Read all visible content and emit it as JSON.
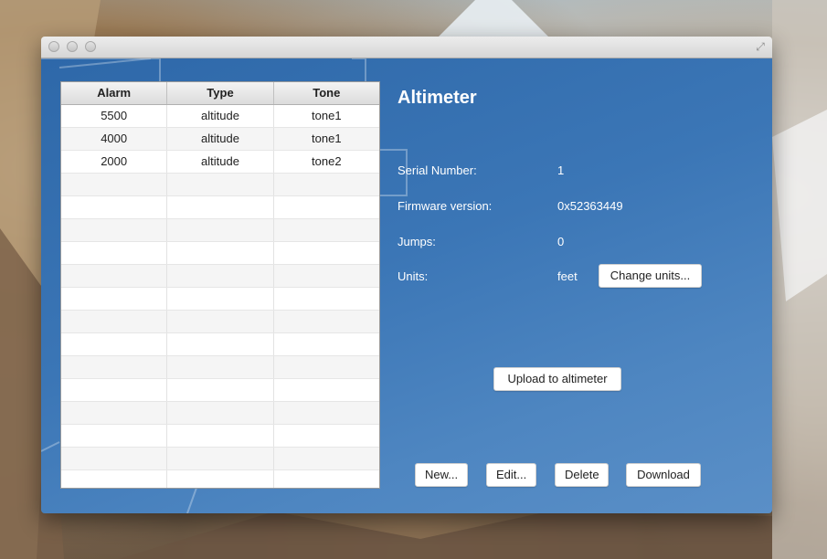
{
  "app": {
    "title": "Altimeter"
  },
  "table": {
    "columns": [
      "Alarm",
      "Type",
      "Tone"
    ],
    "rows": [
      [
        "5500",
        "altitude",
        "tone1"
      ],
      [
        "4000",
        "altitude",
        "tone1"
      ],
      [
        "2000",
        "altitude",
        "tone2"
      ]
    ]
  },
  "info": {
    "serial_label": "Serial Number:",
    "serial_value": "1",
    "firmware_label": "Firmware version:",
    "firmware_value": "0x52363449",
    "jumps_label": "Jumps:",
    "jumps_value": "0",
    "units_label": "Units:",
    "units_value": "feet"
  },
  "buttons": {
    "change_units": "Change units...",
    "upload": "Upload to altimeter",
    "new": "New...",
    "edit": "Edit...",
    "delete": "Delete",
    "download": "Download"
  },
  "colors": {
    "accent": "#3b76b6"
  }
}
